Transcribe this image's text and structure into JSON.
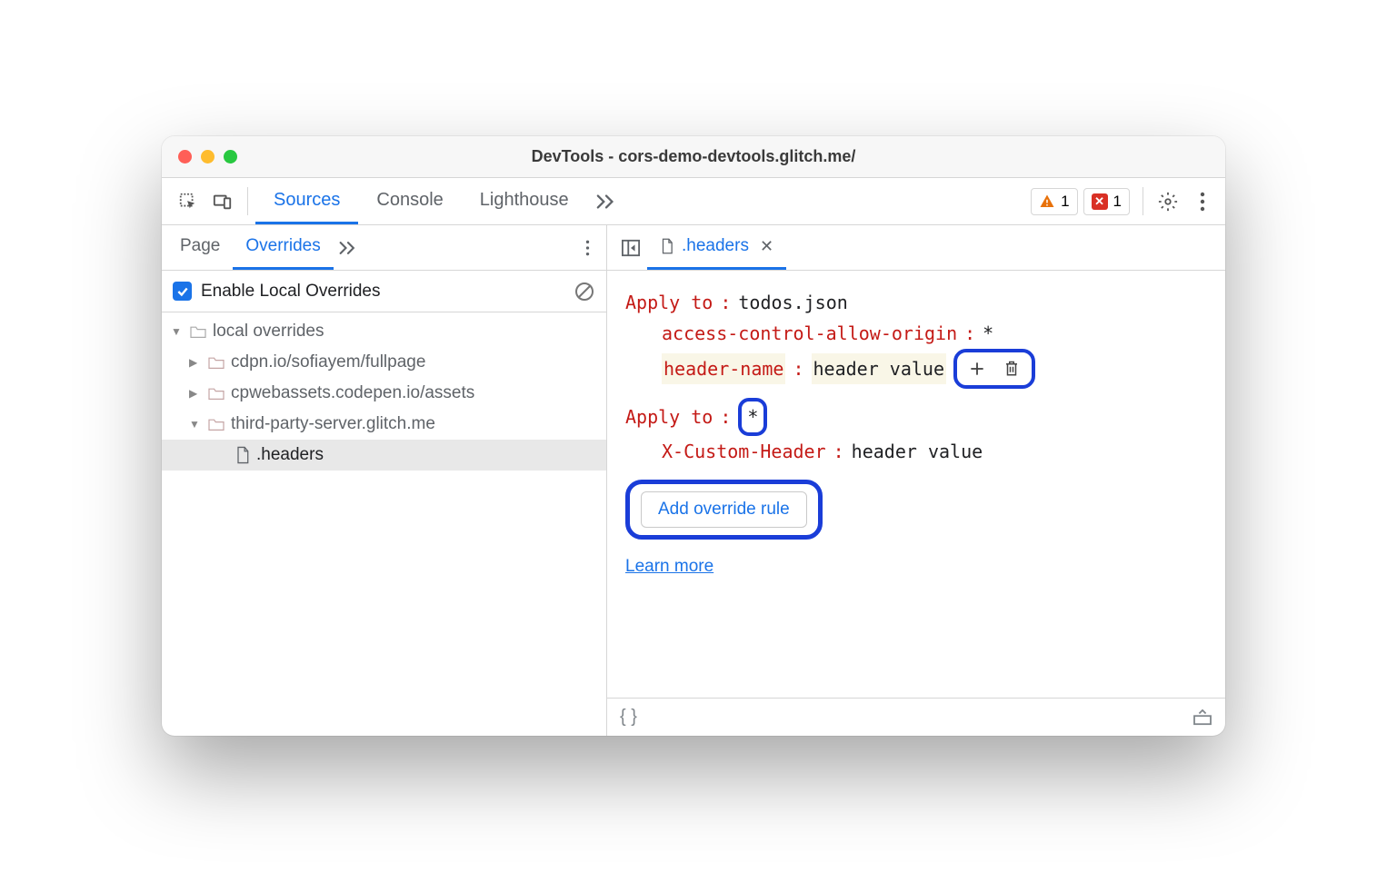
{
  "window": {
    "title": "DevTools - cors-demo-devtools.glitch.me/"
  },
  "main_toolbar": {
    "tabs": [
      "Sources",
      "Console",
      "Lighthouse"
    ],
    "active_tab": "Sources",
    "warnings": "1",
    "errors": "1"
  },
  "left": {
    "subtabs": [
      "Page",
      "Overrides"
    ],
    "active_subtab": "Overrides",
    "enable_label": "Enable Local Overrides",
    "tree": {
      "root": "local overrides",
      "items": [
        "cdpn.io/sofiayem/fullpage",
        "cpwebassets.codepen.io/assets",
        "third-party-server.glitch.me"
      ],
      "file": ".headers"
    }
  },
  "editor": {
    "open_tab": ".headers",
    "sections": [
      {
        "apply_to_label": "Apply to",
        "apply_to_value": "todos.json",
        "headers": [
          {
            "name": "access-control-allow-origin",
            "value": "*"
          },
          {
            "name": "header-name",
            "value": "header value",
            "edit": true
          }
        ]
      },
      {
        "apply_to_label": "Apply to",
        "apply_to_value": "*",
        "highlight_value": true,
        "headers": [
          {
            "name": "X-Custom-Header",
            "value": "header value"
          }
        ]
      }
    ],
    "add_rule_label": "Add override rule",
    "learn_more": "Learn more"
  }
}
